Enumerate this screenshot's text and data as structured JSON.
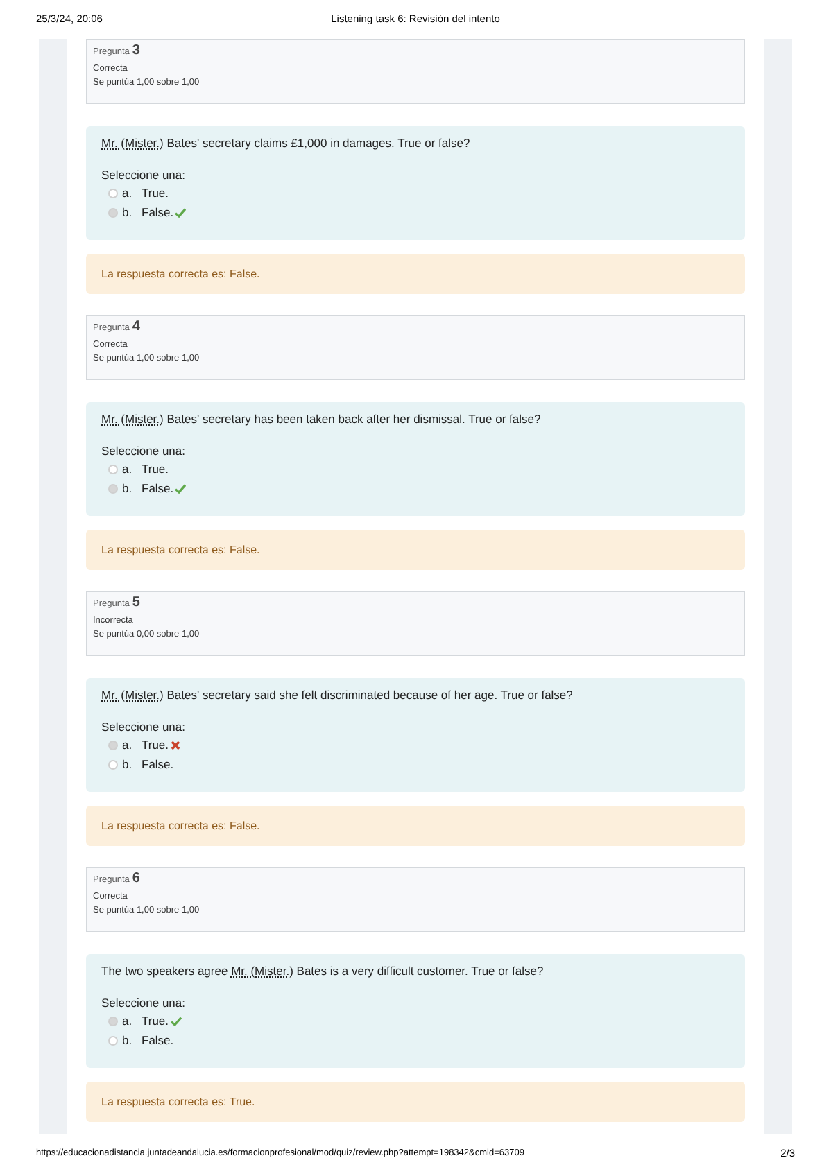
{
  "header": {
    "date": "25/3/24, 20:06",
    "title": "Listening task 6: Revisión del intento"
  },
  "questions": [
    {
      "label": "Pregunta",
      "number": "3",
      "status": "Correcta",
      "score": "Se puntúa 1,00 sobre 1,00",
      "abbr": "Mr. (Mister.)",
      "text_after": " Bates' secretary claims £1,000 in damages. True or false?",
      "prompt": "Seleccione una:",
      "options": [
        {
          "letter": "a.",
          "text": "True.",
          "selected": false,
          "kind": "plain"
        },
        {
          "letter": "b.",
          "text": "False.",
          "selected": true,
          "kind": "correct"
        }
      ],
      "feedback": "La respuesta correcta es: False."
    },
    {
      "label": "Pregunta",
      "number": "4",
      "status": "Correcta",
      "score": "Se puntúa 1,00 sobre 1,00",
      "abbr": "Mr. (Mister.)",
      "text_after": " Bates' secretary has been taken back after her dismissal. True or false?",
      "prompt": "Seleccione una:",
      "options": [
        {
          "letter": "a.",
          "text": "True.",
          "selected": false,
          "kind": "plain"
        },
        {
          "letter": "b.",
          "text": "False.",
          "selected": true,
          "kind": "correct"
        }
      ],
      "feedback": "La respuesta correcta es: False."
    },
    {
      "label": "Pregunta",
      "number": "5",
      "status": "Incorrecta",
      "score": "Se puntúa 0,00 sobre 1,00",
      "abbr": "Mr. (Mister.)",
      "text_after": " Bates' secretary said she felt discriminated because of her age. True or false?",
      "prompt": "Seleccione una:",
      "options": [
        {
          "letter": "a.",
          "text": "True.",
          "selected": true,
          "kind": "incorrect"
        },
        {
          "letter": "b.",
          "text": "False.",
          "selected": false,
          "kind": "plain"
        }
      ],
      "feedback": "La respuesta correcta es: False."
    },
    {
      "label": "Pregunta",
      "number": "6",
      "status": "Correcta",
      "score": "Se puntúa 1,00 sobre 1,00",
      "text_before": "The two speakers agree ",
      "abbr": "Mr. (Mister.)",
      "text_after": " Bates is a very difficult customer. True or false?",
      "prompt": "Seleccione una:",
      "options": [
        {
          "letter": "a.",
          "text": "True.",
          "selected": true,
          "kind": "correct"
        },
        {
          "letter": "b.",
          "text": "False.",
          "selected": false,
          "kind": "plain"
        }
      ],
      "feedback": "La respuesta correcta es: True."
    }
  ],
  "footer": {
    "url": "https://educacionadistancia.juntadeandalucia.es/formacionprofesional/mod/quiz/review.php?attempt=198342&cmid=63709",
    "page": "2/3"
  }
}
